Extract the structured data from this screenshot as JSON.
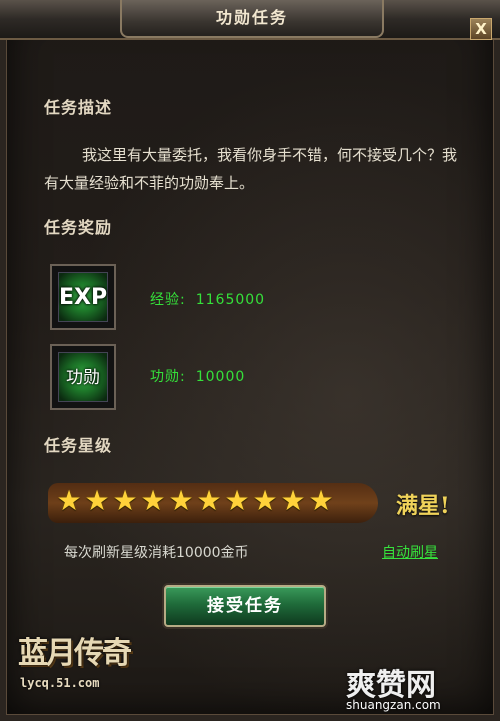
{
  "window": {
    "title": "功勋任务",
    "close_label": "X"
  },
  "sections": {
    "description_title": "任务描述",
    "description_text": "我这里有大量委托，我看你身手不错，何不接受几个？我有大量经验和不菲的功勋奉上。",
    "reward_title": "任务奖励",
    "star_title": "任务星级"
  },
  "rewards": [
    {
      "icon_label": "EXP",
      "icon": "exp-icon",
      "label": "经验:",
      "value": "1165000"
    },
    {
      "icon_label": "功勋",
      "icon": "merit-icon",
      "label": "功勋:",
      "value": "10000"
    }
  ],
  "stars": {
    "filled": 10,
    "total": 10,
    "full_label": "满星!"
  },
  "refresh": {
    "cost_text": "每次刷新星级消耗10000金币",
    "auto_label": "自动刷星"
  },
  "accept_button": "接受任务",
  "branding": {
    "logo_text": "蓝月传奇",
    "logo_url": "lycq.51.com",
    "watermark_text": "爽赞网",
    "watermark_url": "shuangzan.com"
  },
  "colors": {
    "reward_text": "#35e03a",
    "star": "#ffd23a",
    "accept_bg": "#1f6b3a"
  }
}
